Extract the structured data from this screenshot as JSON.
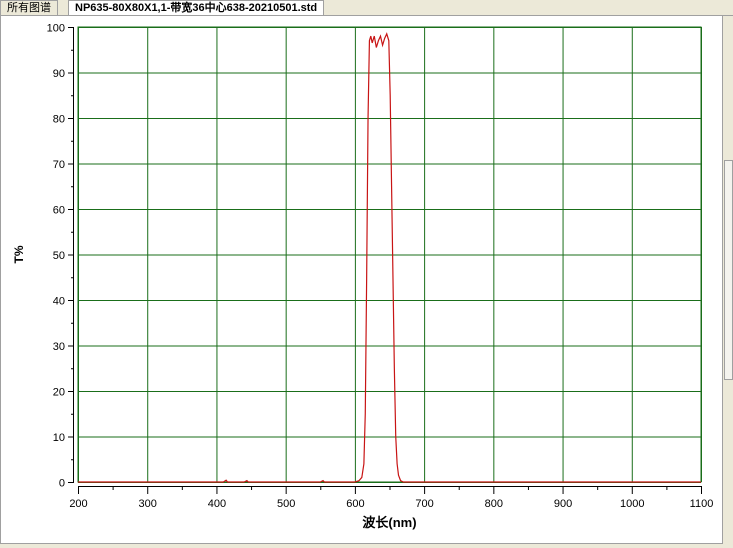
{
  "tabs": [
    {
      "label": "所有图谱"
    },
    {
      "label": "NP635-80X80X1,1-带宽36中心638-20210501.std"
    }
  ],
  "chart_data": {
    "type": "line",
    "xlabel": "波长(nm)",
    "ylabel": "T%",
    "xlim": [
      200,
      1100
    ],
    "ylim": [
      0,
      100
    ],
    "xticks": [
      200,
      300,
      400,
      500,
      600,
      700,
      800,
      900,
      1000,
      1100
    ],
    "yticks": [
      0,
      10,
      20,
      30,
      40,
      50,
      60,
      70,
      80,
      90,
      100
    ],
    "grid": true,
    "colors": {
      "grid": "#1a6e1a",
      "line": "#c81414"
    },
    "series": [
      {
        "name": "T%",
        "x": [
          200,
          410,
          414,
          416,
          440,
          444,
          446,
          550,
          554,
          556,
          600,
          606,
          610,
          613,
          615,
          617,
          619,
          621,
          623,
          625,
          628,
          631,
          634,
          637,
          640,
          643,
          646,
          649,
          651,
          653,
          655,
          657,
          659,
          661,
          663,
          666,
          670,
          1100
        ],
        "y": [
          0,
          0,
          0.4,
          0,
          0,
          0.3,
          0,
          0,
          0.3,
          0,
          0,
          0.3,
          1,
          4,
          15,
          45,
          80,
          97,
          98,
          96.5,
          98,
          95.5,
          97,
          98,
          96,
          97.5,
          98.5,
          97,
          85,
          65,
          45,
          25,
          10,
          4,
          1.5,
          0.3,
          0,
          0
        ]
      }
    ]
  }
}
